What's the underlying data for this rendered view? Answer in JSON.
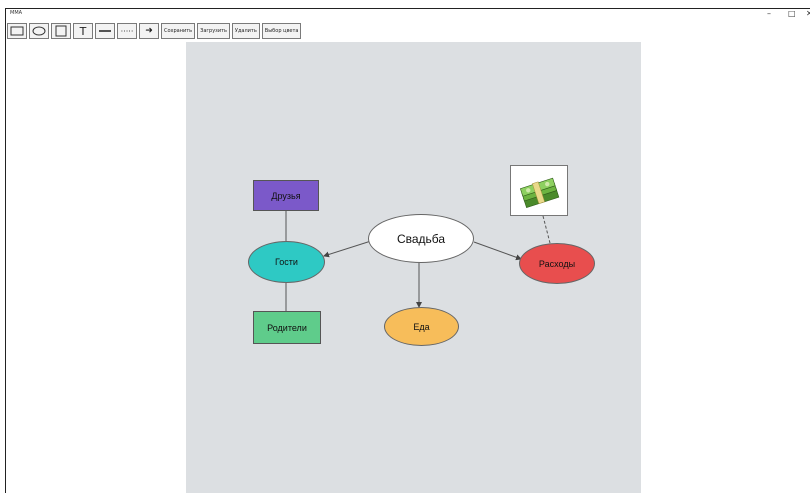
{
  "window": {
    "title": "MMA",
    "minimize": "–",
    "maximize": "□",
    "close": "✕"
  },
  "toolbar": {
    "tools": [
      "rectangle-tool",
      "ellipse-tool",
      "square-tool",
      "text-tool",
      "line-tool",
      "dashed-line-tool",
      "arrow-tool"
    ],
    "text_tool": "T",
    "dashed_tool": "·····",
    "arrow_tool": "➜",
    "save": "Сохранить",
    "load": "Загрузить",
    "delete": "Удалить",
    "color": "Выбор цвета"
  },
  "diagram": {
    "center": "Свадьба",
    "guests": "Гости",
    "friends": "Друзья",
    "parents": "Родители",
    "food": "Еда",
    "expenses": "Расходы",
    "colors": {
      "canvas": "#dcdfe2",
      "friends": "#7b59c9",
      "guests": "#2ec9c4",
      "parents": "#5fcc8b",
      "food": "#f7bd5a",
      "expenses": "#e84e4e",
      "center": "#ffffff"
    },
    "image": "money-icon"
  }
}
